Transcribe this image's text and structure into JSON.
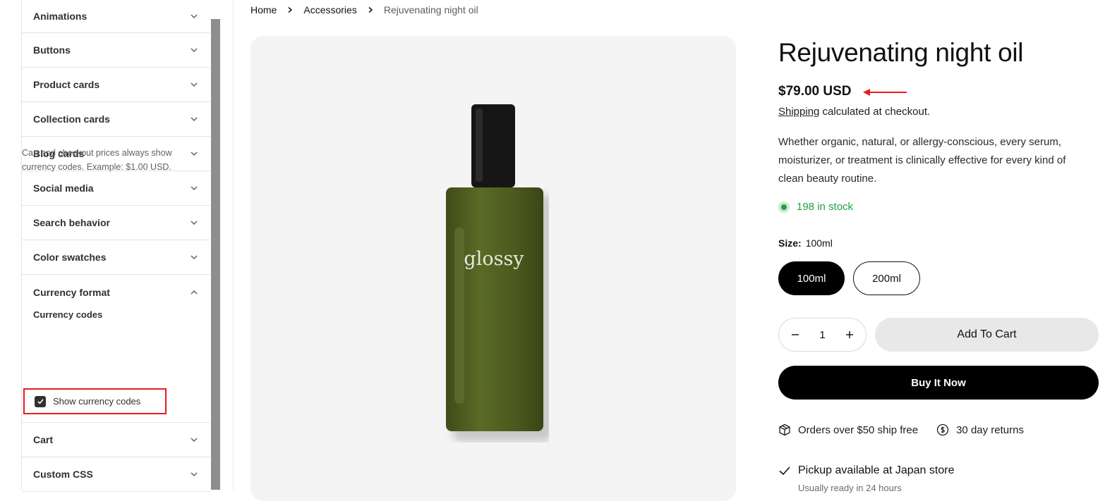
{
  "settings": {
    "items": [
      {
        "label": "Animations"
      },
      {
        "label": "Buttons"
      },
      {
        "label": "Product cards"
      },
      {
        "label": "Collection cards"
      },
      {
        "label": "Blog cards"
      },
      {
        "label": "Social media"
      },
      {
        "label": "Search behavior"
      },
      {
        "label": "Color swatches"
      }
    ],
    "open_section": {
      "label": "Currency format",
      "subheading": "Currency codes",
      "description": "Cart and checkout prices always show currency codes. Example: $1.00 USD.",
      "checkbox_label": "Show currency codes",
      "checkbox_checked": true
    },
    "items_after": [
      {
        "label": "Cart"
      },
      {
        "label": "Custom CSS"
      }
    ]
  },
  "store": {
    "breadcrumb": [
      "Home",
      "Accessories",
      "Rejuvenating night oil"
    ],
    "product": {
      "title": "Rejuvenating night oil",
      "price": "$79.00 USD",
      "shipping_link": "Shipping",
      "shipping_rest": " calculated at checkout.",
      "description": "Whether organic, natural, or allergy-conscious, every serum, moisturizer, or treatment is clinically effective for every kind of clean beauty routine.",
      "stock": "198 in stock",
      "size_label": "Size:",
      "size_value": "100ml",
      "sizes": [
        "100ml",
        "200ml"
      ],
      "quantity": "1",
      "add_to_cart": "Add To Cart",
      "buy_now": "Buy It Now",
      "perk_shipping": "Orders over $50 ship free",
      "perk_returns": "30 day returns",
      "pickup": "Pickup available at Japan store",
      "pickup_ready": "Usually ready in 24 hours",
      "bottle_brand": "glossy"
    },
    "colors": {
      "stock_green": "#20a145",
      "annotation_red": "#e51c23",
      "bottle_green": "#4b5a1e"
    }
  }
}
